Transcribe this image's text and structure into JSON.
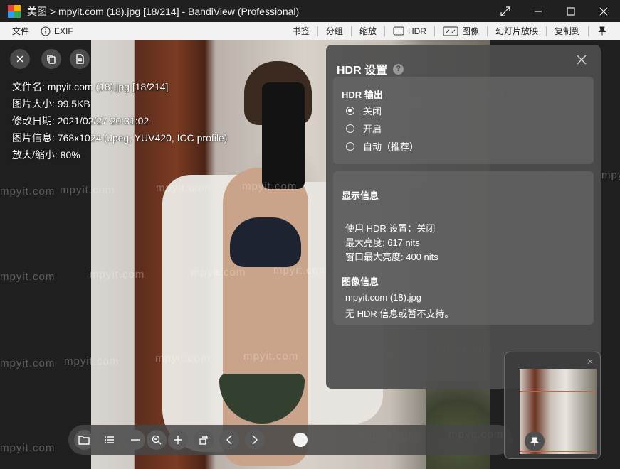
{
  "window": {
    "title": "美图 > mpyit.com (18).jpg [18/214] - BandiView (Professional)"
  },
  "menubar": {
    "file": "文件",
    "exif": "EXIF",
    "bookmark": "书签",
    "group": "分组",
    "zoom": "缩放",
    "hdr": "HDR",
    "image": "图像",
    "slideshow": "幻灯片放映",
    "copy_to": "复制到"
  },
  "image_info": {
    "filename": "文件名: mpyit.com (18).jpg [18/214]",
    "size": "图片大小: 99.5KB",
    "modified": "修改日期: 2021/02/27 20:31:02",
    "details": "图片信息: 768x1024 (Jpeg, YUV420, ICC profile)",
    "zoom": "放大/缩小: 80%"
  },
  "hdr_panel": {
    "title": "HDR 设置",
    "help": "?",
    "output_title": "HDR 输出",
    "options": [
      "关闭",
      "开启",
      "自动（推荐）"
    ],
    "selected_option": "关闭",
    "display_title": "显示信息",
    "use_hdr": "使用 HDR 设置：关闭",
    "max_brightness": "最大亮度: 617 nits",
    "window_max_brightness": "窗口最大亮度: 400 nits",
    "image_info_title": "图像信息",
    "image_name": "mpyit.com (18).jpg",
    "hdr_support": "无 HDR 信息或暂不支持。"
  },
  "watermark_text": "mpyit.com",
  "colors": {
    "titlebar": "#202020",
    "menubar": "#f2f2f2",
    "panel": "#4e4e4e",
    "accent_frame": "#e05a3a"
  },
  "icons": [
    "close-icon",
    "copy-icon",
    "document-icon",
    "folder-icon",
    "list-icon",
    "zoom-out-icon",
    "magnifier-icon",
    "zoom-in-icon",
    "rotate-icon",
    "prev-icon",
    "next-icon",
    "pin-icon",
    "expand-icon",
    "minimize-icon",
    "maximize-icon"
  ]
}
